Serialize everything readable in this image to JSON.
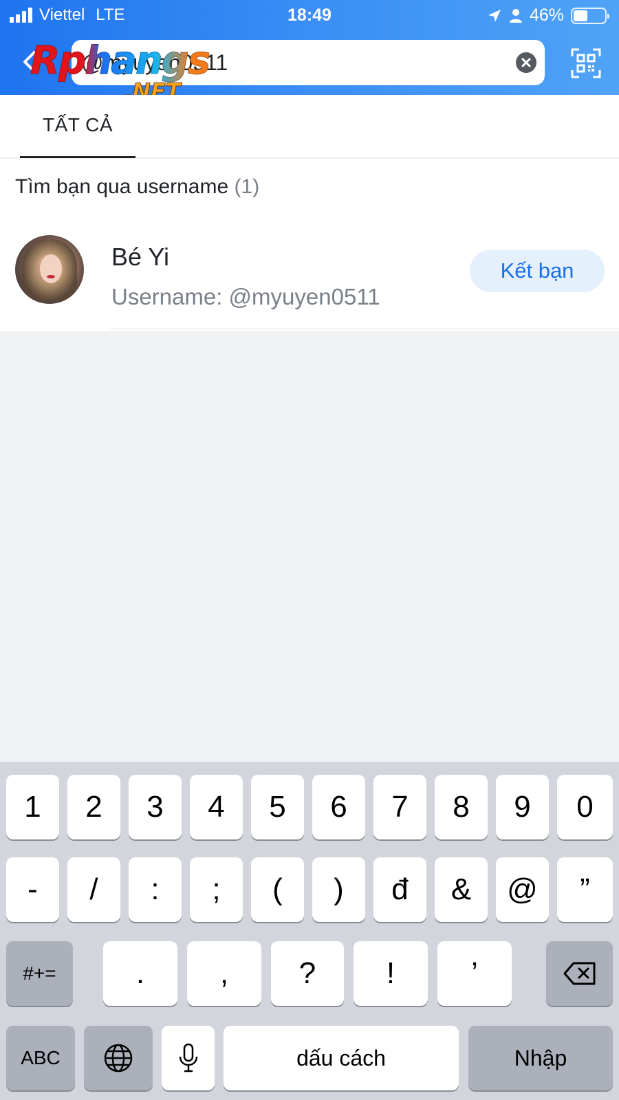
{
  "status_bar": {
    "carrier": "Viettel",
    "network": "LTE",
    "time": "18:49",
    "battery": "46%",
    "battery_level": 0.46
  },
  "search": {
    "value": "@myuyen0511",
    "watermark_main": "Rphangs",
    "watermark_sub": ".NET"
  },
  "tabs": [
    {
      "label": "TẤT CẢ",
      "active": true
    }
  ],
  "results": {
    "section_title": "Tìm bạn qua username",
    "section_count": "(1)",
    "items": [
      {
        "name": "Bé Yi",
        "username": "Username: @myuyen0511",
        "action": "Kết bạn"
      }
    ]
  },
  "keyboard": {
    "row1": [
      "1",
      "2",
      "3",
      "4",
      "5",
      "6",
      "7",
      "8",
      "9",
      "0"
    ],
    "row2": [
      "-",
      "/",
      ":",
      ";",
      "(",
      ")",
      "đ",
      "&",
      "@",
      "”"
    ],
    "row3": [
      "#+=",
      ".",
      ",",
      "?",
      "!",
      "’"
    ],
    "bottom": {
      "abc": "ABC",
      "space": "dấu cách",
      "return": "Nhập"
    }
  },
  "colors": {
    "header_start": "#1f74f0",
    "header_end": "#50a3f6",
    "accent": "#1a6fe8",
    "button_bg": "#e5f0fd"
  }
}
